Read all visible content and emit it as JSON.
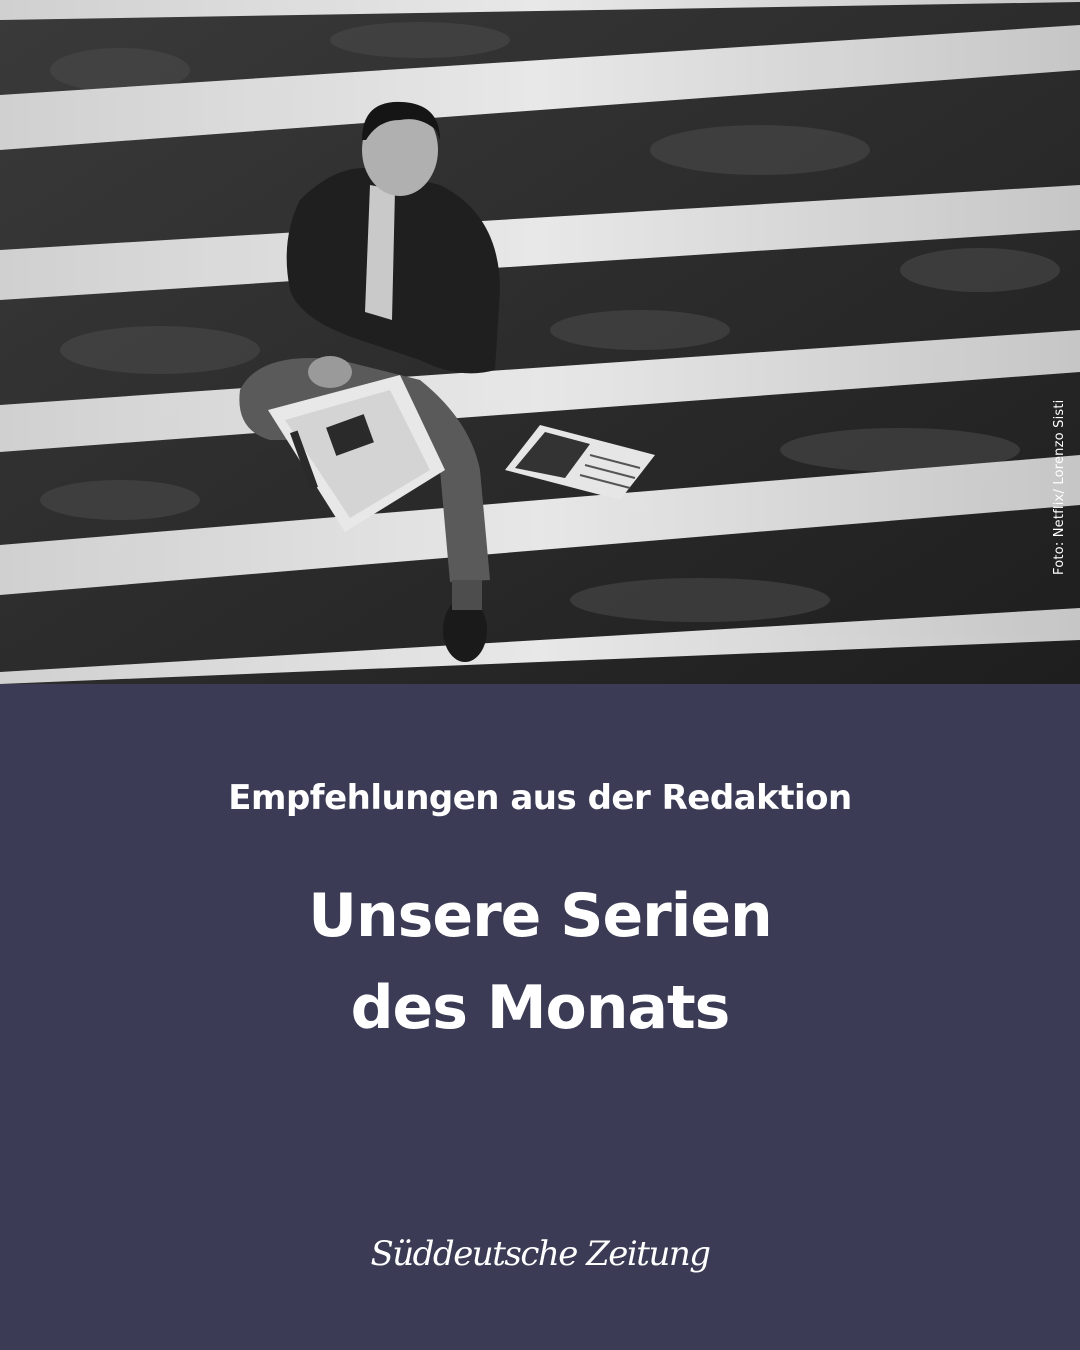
{
  "photo": {
    "alt_subject": "man-sitting-on-stairs-reading-newspaper",
    "credit": "Foto: Netflix/ Lorenzo Sisti"
  },
  "content": {
    "kicker": "Empfehlungen aus der Redaktion",
    "headline_line1": "Unsere Serien",
    "headline_line2": "des Monats"
  },
  "brand": {
    "logo_text": "Süddeutsche Zeitung"
  },
  "colors": {
    "panel_background": "#3b3b55",
    "text": "#ffffff"
  }
}
